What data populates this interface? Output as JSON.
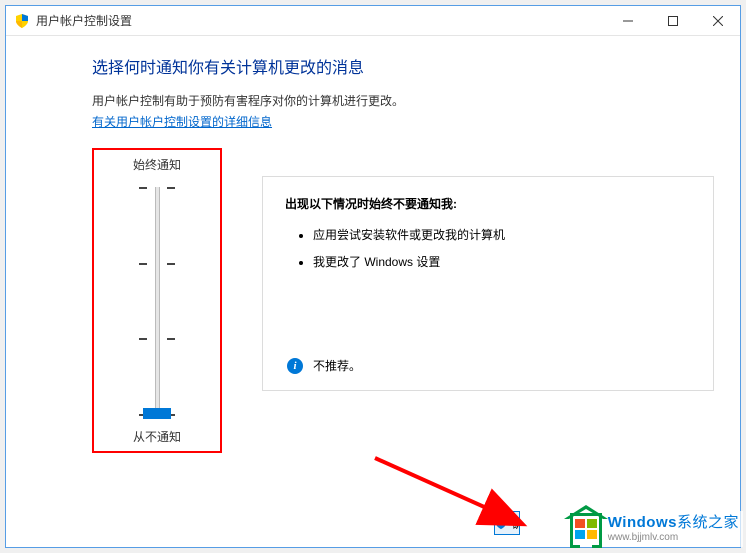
{
  "window": {
    "title": "用户帐户控制设置"
  },
  "page": {
    "heading": "选择何时通知你有关计算机更改的消息",
    "description": "用户帐户控制有助于预防有害程序对你的计算机进行更改。",
    "link_text": "有关用户帐户控制设置的详细信息"
  },
  "slider": {
    "top_label": "始终通知",
    "bottom_label": "从不通知",
    "levels": 4,
    "current_level": 0
  },
  "info": {
    "heading": "出现以下情况时始终不要通知我:",
    "bullets": [
      "应用尝试安装软件或更改我的计算机",
      "我更改了 Windows 设置"
    ],
    "recommendation": "不推荐。"
  },
  "buttons": {
    "ok_label": "确"
  },
  "watermark": {
    "line1_brand": "Windows",
    "line1_suffix": "系统之家",
    "line2": "www.bjjmlv.com"
  }
}
